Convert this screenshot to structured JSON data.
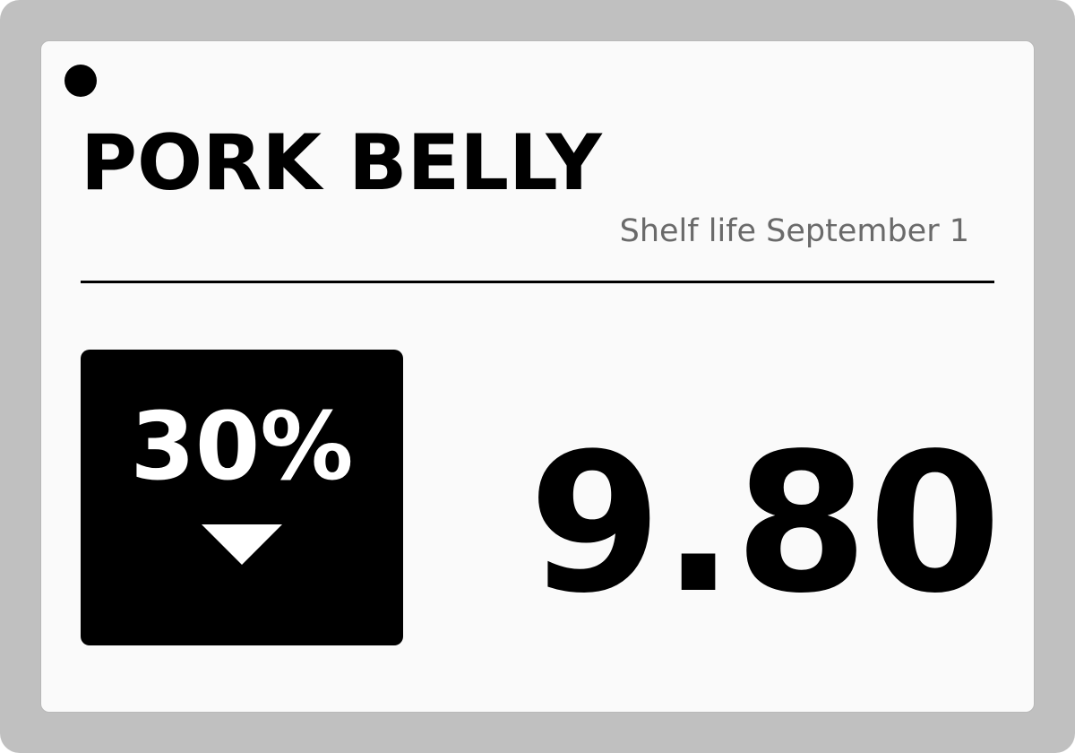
{
  "label": {
    "product_name": "PORK BELLY",
    "shelf_life": "Shelf life September 1",
    "discount": "30%",
    "discount_icon": "down-arrow-icon",
    "price": "9.80",
    "colors": {
      "bezel": "#c0c0c0",
      "screen": "#fafafa",
      "ink": "#000000",
      "secondary_text": "#6a6a6a"
    }
  }
}
